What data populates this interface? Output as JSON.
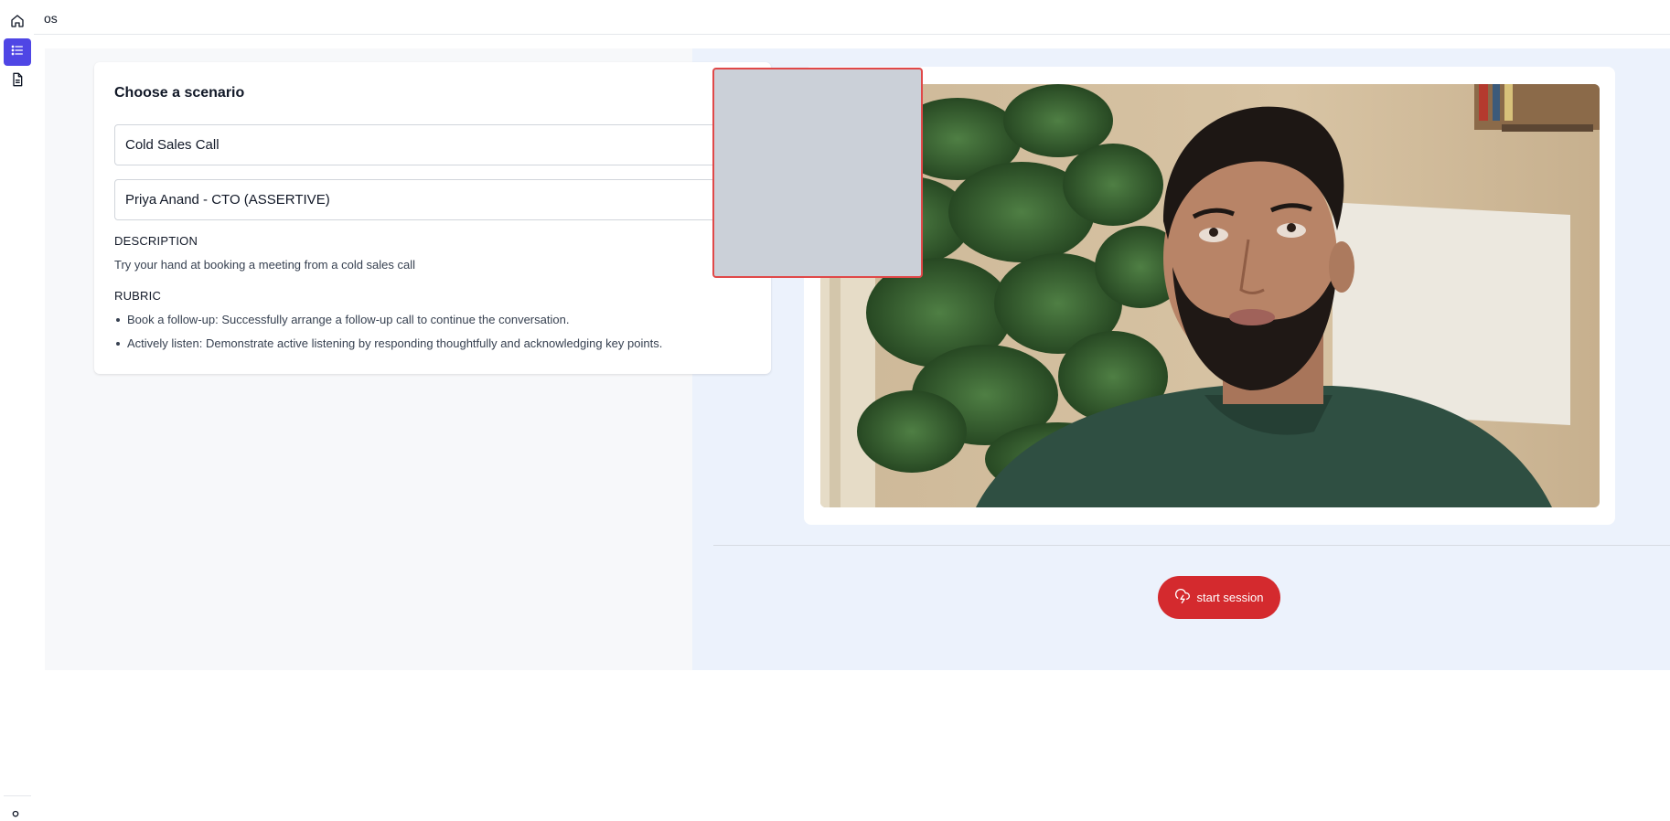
{
  "app": {
    "title": "os"
  },
  "sidebar": {
    "items": [
      {
        "icon": "home-icon",
        "active": false
      },
      {
        "icon": "list-icon",
        "active": true
      },
      {
        "icon": "document-icon",
        "active": false
      }
    ],
    "bottom_icon": "user-icon"
  },
  "scenario": {
    "heading": "Choose a scenario",
    "scenario_select": "Cold Sales Call",
    "persona_select": "Priya Anand - CTO (ASSERTIVE)",
    "description_label": "DESCRIPTION",
    "description": "Try your hand at booking a meeting from a cold sales call",
    "rubric_label": "RUBRIC",
    "rubric": [
      "Book a follow-up: Successfully arrange a follow-up call to continue the conversation.",
      "Actively listen: Demonstrate active listening by responding thoughtfully and acknowledging key points."
    ]
  },
  "session": {
    "start_label": "start session",
    "start_icon": "cloud-lightning-icon"
  },
  "colors": {
    "accent": "#4f46e5",
    "start_button": "#d42a2e",
    "placeholder_border": "#e04848"
  }
}
